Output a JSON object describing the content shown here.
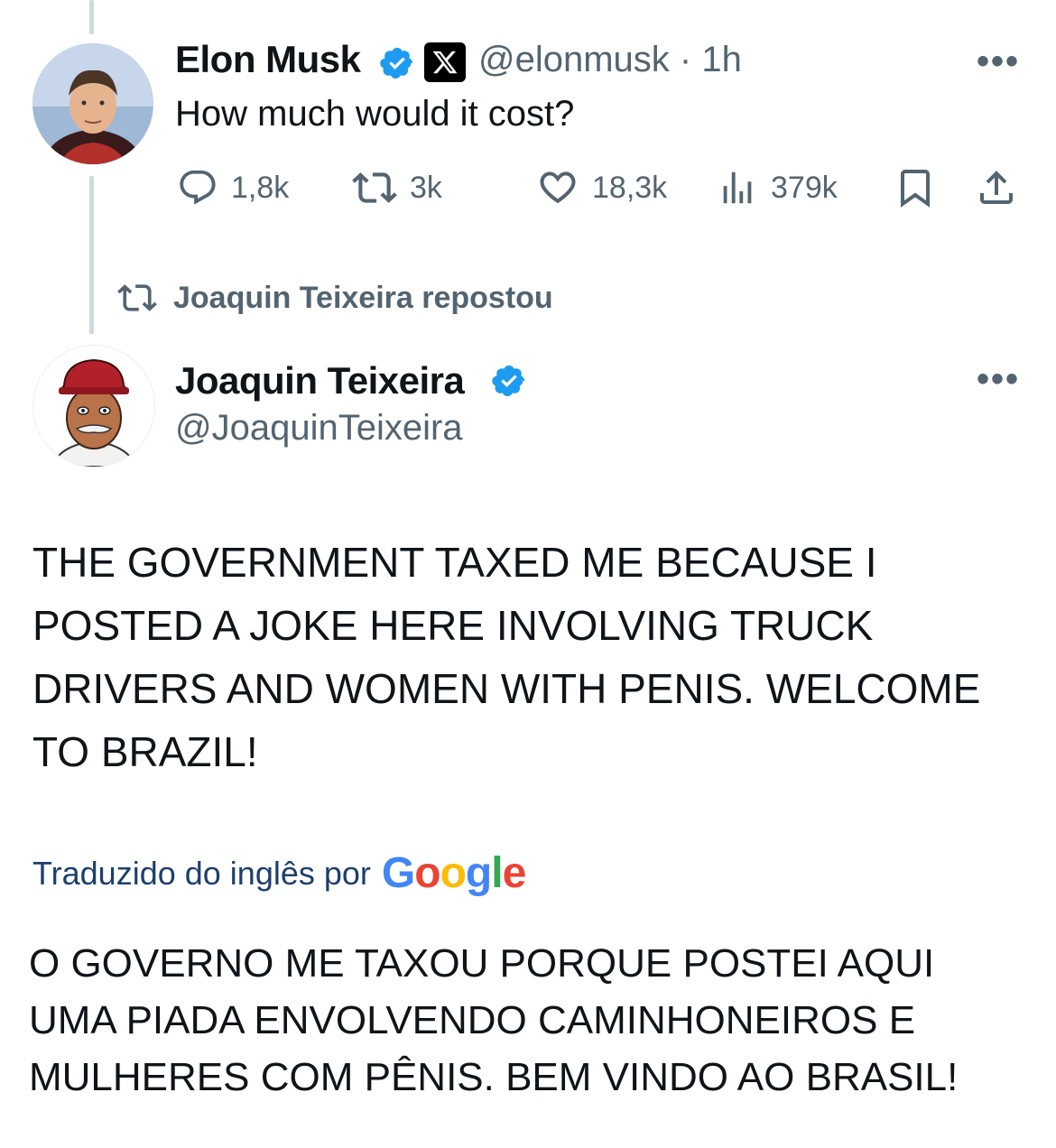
{
  "original_tweet": {
    "author_name": "Elon Musk",
    "handle": "@elonmusk",
    "separator": "·",
    "time": "1h",
    "text": "How much would it cost?",
    "more_label": "•••",
    "stats": {
      "replies": "1,8k",
      "reposts": "3k",
      "likes": "18,3k",
      "views": "379k"
    }
  },
  "repost_banner": {
    "text": "Joaquin Teixeira repostou"
  },
  "quoted_tweet": {
    "author_name": "Joaquin Teixeira",
    "handle": "@JoaquinTeixeira",
    "more_label": "•••",
    "body": "THE GOVERNMENT TAXED ME BECAUSE I POSTED A JOKE HERE INVOLVING TRUCK DRIVERS AND WOMEN WITH PENIS. WELCOME TO BRAZIL!",
    "translated_by": "Traduzido do inglês por",
    "translation_logo": "Google",
    "translation": "O GOVERNO ME TAXOU PORQUE POSTEI AQUI UMA PIADA ENVOLVENDO CAMINHONEIROS E MULHERES COM PÊNIS. BEM VINDO AO BRASIL!"
  },
  "colors": {
    "verified_blue": "#1d9bf0",
    "muted_text": "#536471",
    "thread_line": "#cfd9de"
  },
  "icons": [
    "reply-icon",
    "repost-icon",
    "like-icon",
    "views-icon",
    "bookmark-icon",
    "share-icon",
    "verified-badge-icon",
    "x-affiliate-icon"
  ]
}
